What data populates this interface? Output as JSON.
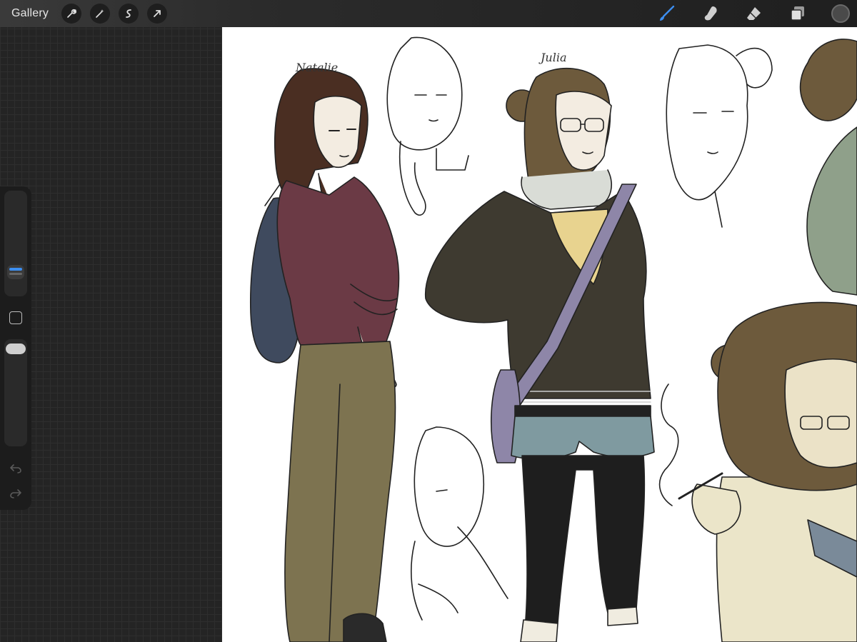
{
  "toolbar": {
    "gallery_label": "Gallery",
    "left_tools": [
      "wrench-icon",
      "magic-wand-icon",
      "selection-icon",
      "transform-arrow-icon"
    ],
    "right_tools": [
      "brush-icon",
      "smudge-icon",
      "eraser-icon",
      "layers-icon"
    ],
    "active_tool": "brush",
    "active_color": "#3c8ef0",
    "current_color": "#4a4a4a"
  },
  "sidebar": {
    "brush_size_level": 0.22,
    "brush_opacity_level": 1.0
  },
  "canvas": {
    "labels": {
      "natalie": "Natalie",
      "julia": "Julia"
    },
    "palette": {
      "natalie_hair": "#4a2e22",
      "natalie_top": "#6b3a45",
      "natalie_pants": "#7d7350",
      "backpack": "#3f4a5e",
      "julia_hair": "#6d5a3c",
      "julia_hoodie": "#3e3a30",
      "julia_shirt": "#e8d38f",
      "julia_shorts": "#7f9aa0",
      "julia_leggings": "#1e1e1e",
      "strap": "#8e86a8",
      "skin": "#f1ebdf",
      "green_shirt": "#8fa08a",
      "cream_shirt": "#ebe5c9"
    }
  }
}
